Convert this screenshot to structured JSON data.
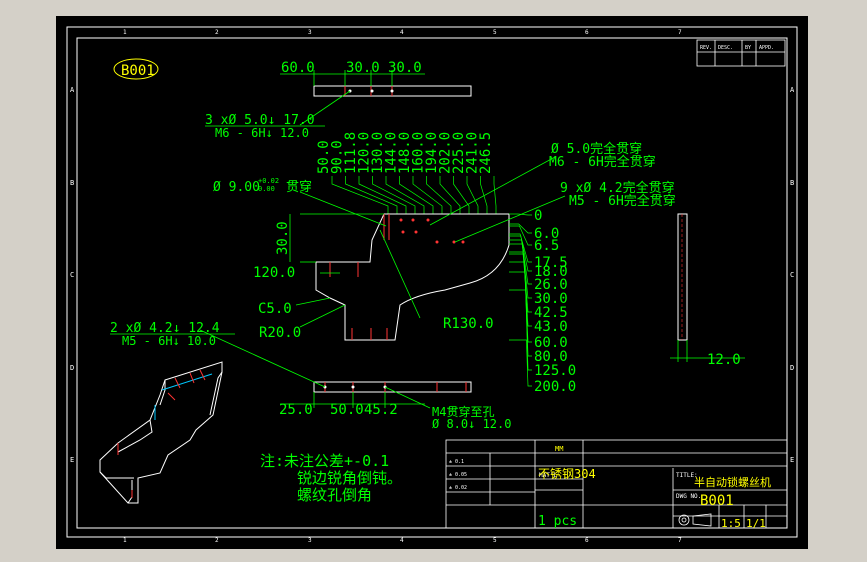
{
  "drawing": {
    "id_label": "B001",
    "top_dims": [
      "60.0",
      "30.0",
      "30.0"
    ],
    "hole_callout_top": [
      "3 xØ 5.0↓ 17.0",
      "M6 - 6H↓ 12.0"
    ],
    "hole_x_positions": [
      "50.0",
      "90.0",
      "111.8",
      "120.0",
      "130.0",
      "144.0",
      "148.0",
      "160.0",
      "194.0",
      "202.0",
      "225.0",
      "241.0",
      "246.5"
    ],
    "callout_thru": [
      "Ø 5.0完全贯穿",
      "M6 - 6H完全贯穿"
    ],
    "callout_9x": [
      "9 xØ 4.2完全贯穿",
      "M5 - 6H完全贯穿"
    ],
    "bore_callout": "Ø 9.00",
    "bore_tol_upper": "+0.02",
    "bore_tol_lower": "0.00",
    "bore_suffix": "贯穿",
    "dim_30": "30.0",
    "dim_120": "120.0",
    "chamfer_c5": "C5.0",
    "radius_r20": "R20.0",
    "radius_r130": "R130.0",
    "y_ordinates": [
      "0",
      "6.0",
      "6.5",
      "17.5",
      "18.0",
      "26.0",
      "30.0",
      "42.5",
      "43.0",
      "60.0",
      "80.0",
      "125.0",
      "200.0"
    ],
    "hole_callout_bottom": [
      "2 xØ 4.2↓ 12.4",
      "M5 - 6H↓ 10.0"
    ],
    "bottom_dims": [
      "25.0",
      "50.0",
      "45.2"
    ],
    "m4_callout": [
      "M4贯穿至孔",
      "Ø 8.0↓ 12.0"
    ],
    "side_dim": "12.0",
    "notes": [
      "注:未注公差+-0.1",
      "锐边锐角倒钝。",
      "螺纹孔倒角"
    ],
    "title_block": {
      "material_label": "MAT'L",
      "material_value": "不锈钢304",
      "qty_value": "1 pcs",
      "title_label": "TITLE:",
      "title_value": "半自动锁螺丝机",
      "dwg_label": "DWG NO.",
      "dwg_value": "B001",
      "scale_value": "1:5",
      "sheet_value": "1/1",
      "unit_value": "MM",
      "small_left": [
        "± 0.1",
        "± 0.05",
        "± 0.02"
      ]
    },
    "revision_headers": [
      "REV.",
      "DESC.",
      "BY",
      "APPD."
    ],
    "row_letters": [
      "A",
      "B",
      "C",
      "D",
      "E"
    ],
    "col_numbers": [
      "1",
      "2",
      "3",
      "4",
      "5",
      "6",
      "7"
    ]
  }
}
